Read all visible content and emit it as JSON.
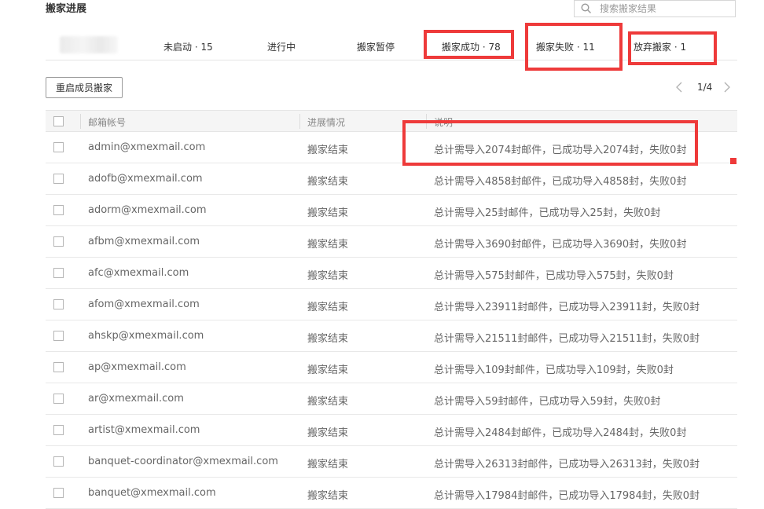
{
  "page": {
    "title": "搬家进展"
  },
  "search": {
    "placeholder": "搜索搬家结果"
  },
  "tabs": [
    {
      "label": "未启动 · 15"
    },
    {
      "label": "进行中"
    },
    {
      "label": "搬家暂停"
    },
    {
      "label": "搬家成功 · 78"
    },
    {
      "label": "搬家失败 · 11"
    },
    {
      "label": "放弃搬家 · 1"
    }
  ],
  "toolbar": {
    "restart_label": "重启成员搬家"
  },
  "pagination": {
    "text": "1/4"
  },
  "table": {
    "headers": {
      "email": "邮箱帐号",
      "status": "进展情况",
      "desc": "说明"
    },
    "rows": [
      {
        "email": "admin@xmexmail.com",
        "status": "搬家结束",
        "desc": "总计需导入2074封邮件，已成功导入2074封，失败0封"
      },
      {
        "email": "adofb@xmexmail.com",
        "status": "搬家结束",
        "desc": "总计需导入4858封邮件，已成功导入4858封，失败0封"
      },
      {
        "email": "adorm@xmexmail.com",
        "status": "搬家结束",
        "desc": "总计需导入25封邮件，已成功导入25封，失败0封"
      },
      {
        "email": "afbm@xmexmail.com",
        "status": "搬家结束",
        "desc": "总计需导入3690封邮件，已成功导入3690封，失败0封"
      },
      {
        "email": "afc@xmexmail.com",
        "status": "搬家结束",
        "desc": "总计需导入575封邮件，已成功导入575封，失败0封"
      },
      {
        "email": "afom@xmexmail.com",
        "status": "搬家结束",
        "desc": "总计需导入23911封邮件，已成功导入23911封，失败0封"
      },
      {
        "email": "ahskp@xmexmail.com",
        "status": "搬家结束",
        "desc": "总计需导入21511封邮件，已成功导入21511封，失败0封"
      },
      {
        "email": "ap@xmexmail.com",
        "status": "搬家结束",
        "desc": "总计需导入109封邮件，已成功导入109封，失败0封"
      },
      {
        "email": "ar@xmexmail.com",
        "status": "搬家结束",
        "desc": "总计需导入59封邮件，已成功导入59封，失败0封"
      },
      {
        "email": "artist@xmexmail.com",
        "status": "搬家结束",
        "desc": "总计需导入2484封邮件，已成功导入2484封，失败0封"
      },
      {
        "email": "banquet-coordinator@xmexmail.com",
        "status": "搬家结束",
        "desc": "总计需导入26313封邮件，已成功导入26313封，失败0封"
      },
      {
        "email": "banquet@xmexmail.com",
        "status": "搬家结束",
        "desc": "总计需导入17984封邮件，已成功导入17984封，失败0封"
      }
    ]
  },
  "colors": {
    "annotation": "#ee3a3a",
    "header_bg": "#f5f5f5",
    "border": "#e5e5e5"
  }
}
